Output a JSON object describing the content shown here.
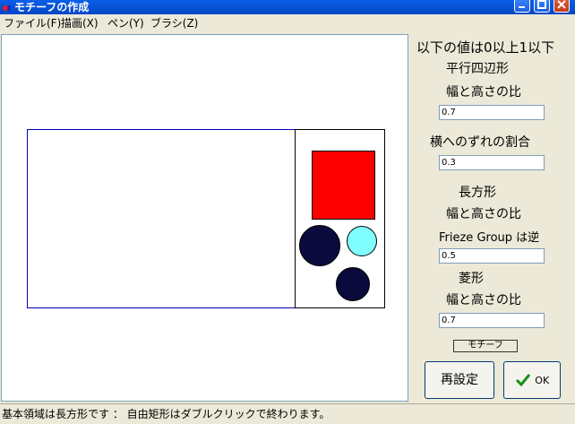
{
  "window": {
    "title": "モチーフの作成"
  },
  "menu": [
    {
      "label": "ファイル(F)"
    },
    {
      "label": "描画(X)"
    },
    {
      "label": "ペン(Y)"
    },
    {
      "label": "ブラシ(Z)"
    }
  ],
  "panel": {
    "header": "以下の値は0以上1以下",
    "parallelogram": {
      "title": "平行四辺形",
      "ratio_label": "幅と高さの比",
      "ratio_value": "0.7",
      "shift_label": "横へのずれの割合",
      "shift_value": "0.3"
    },
    "rectangle": {
      "title": "長方形",
      "ratio_label": "幅と高さの比",
      "note": "Frieze Group は逆",
      "ratio_value": "0.5"
    },
    "rhombus": {
      "title": "菱形",
      "ratio_label": "幅と高さの比",
      "ratio_value": "0.7"
    },
    "motif_button": "モチーフ",
    "reset_button": "再設定",
    "ok_button": "OK"
  },
  "status": "基本領域は長方形です ： 自由矩形はダブルクリックで終わります。",
  "colors": {
    "square": "#FF0000",
    "circle_dark": "#0A0A3C",
    "circle_light": "#80FFFF",
    "region_border": "#0000C0"
  }
}
